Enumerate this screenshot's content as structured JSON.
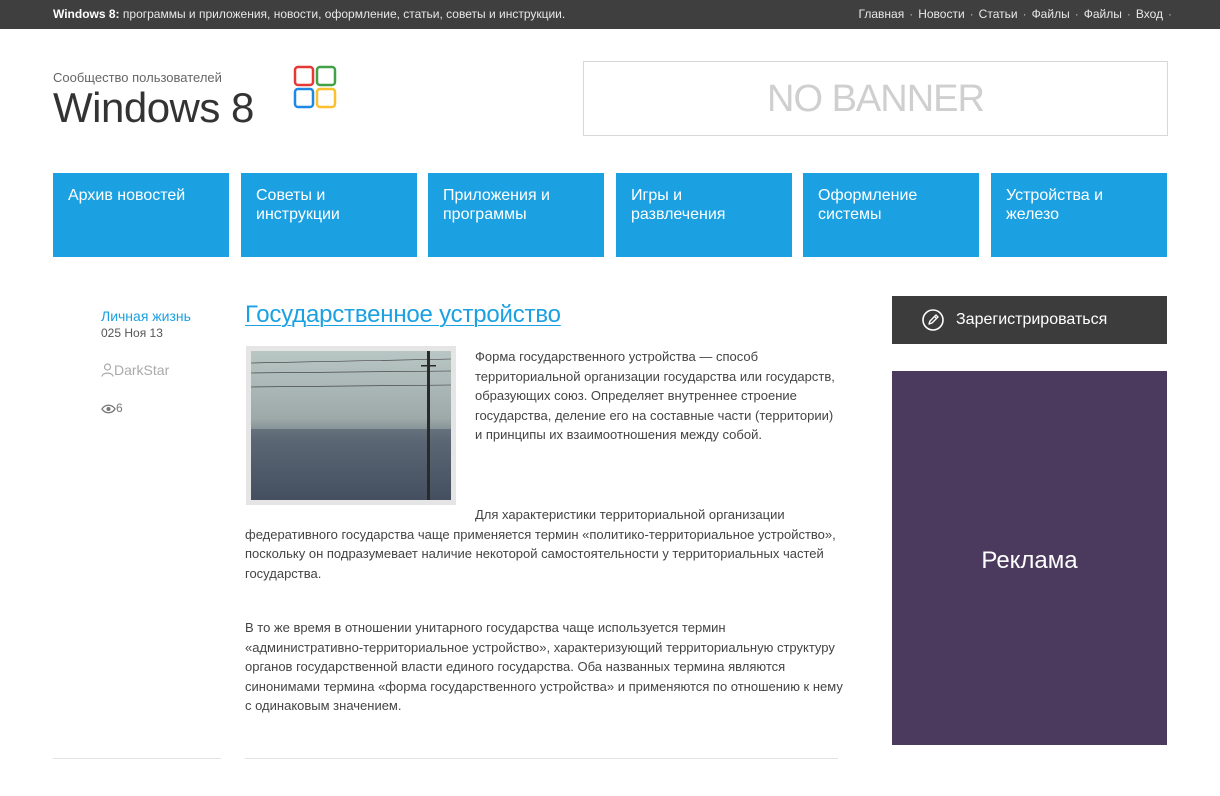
{
  "topbar": {
    "site_name": "Windows 8:",
    "tagline": " программы и приложения, новости, оформление, статьи, советы и инструкции.",
    "links": [
      "Главная",
      "Новости",
      "Статьи",
      "Файлы",
      "Файлы",
      "Вход"
    ],
    "separator": "·"
  },
  "logo": {
    "subtitle": "Сообщество пользователей",
    "title": "Windows 8",
    "icon": "windows-logo-icon",
    "colors": [
      "#e53935",
      "#43a047",
      "#1e88e5",
      "#fbc02d"
    ]
  },
  "banner": {
    "text": "NO BANNER"
  },
  "nav": {
    "items": [
      {
        "label": "Архив новостей"
      },
      {
        "label": "Советы и инструкции"
      },
      {
        "label": "Приложения и программы"
      },
      {
        "label": "Игры и развлечения"
      },
      {
        "label": "Оформление системы"
      },
      {
        "label": "Устройства и железо"
      }
    ],
    "accent": "#1ba1e2"
  },
  "post": {
    "category": "Личная жизнь",
    "date": "025 Ноя 13",
    "author": "DarkStar",
    "views": "6",
    "title": "Государственное устройство",
    "paragraph1": "Форма государственного устройства — способ территориальной организации государства или государств, образующих союз. Определяет внутреннее строение государства, деление его на составные части (территории) и принципы их взаимоотношения между собой.",
    "paragraph2": "Для характеристики территориальной организации федеративного государства чаще применяется термин «политико-территориальное устройство», поскольку он подразумевает наличие некоторой самостоятельности у территориальных частей государства.",
    "paragraph3": "В то же время в отношении унитарного государства чаще используется термин «административно-территориальное устройство», характеризующий территориальную структуру органов государственной власти единого государства. Оба названных термина являются синонимами термина «форма государственного устройства» и применяются по отношению к нему с одинаковым значением."
  },
  "sidebar": {
    "register_label": "Зарегистрироваться",
    "register_icon": "pencil-circle-icon",
    "ad_label": "Реклама",
    "ad_color": "#4b3a5e"
  }
}
